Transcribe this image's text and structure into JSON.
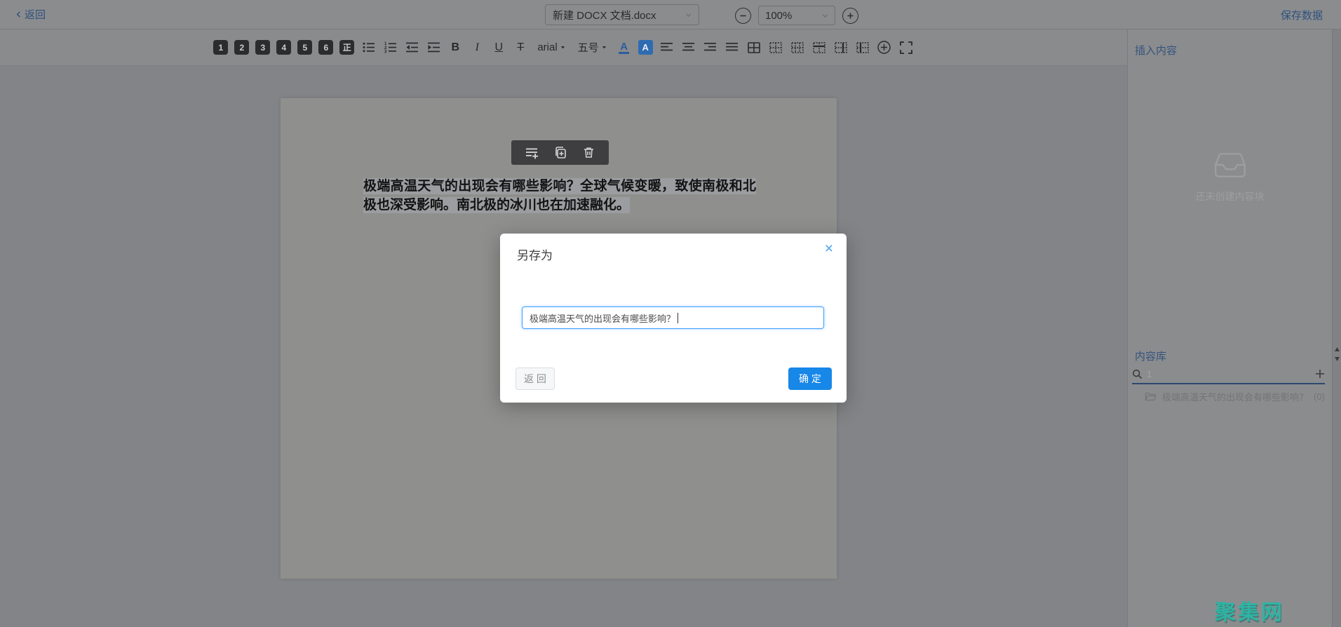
{
  "topbar": {
    "back_label": "返回",
    "doc_title": "新建 DOCX 文档.docx",
    "zoom_value": "100%",
    "save_label": "保存数据"
  },
  "toolbar": {
    "headings": [
      "1",
      "2",
      "3",
      "4",
      "5",
      "6"
    ],
    "normal_label": "正",
    "bold_label": "B",
    "italic_label": "I",
    "underline_label": "U",
    "strike_label": "T",
    "font_name": "arial",
    "font_size": "五号",
    "font_color_letter": "A",
    "highlight_letter": "A"
  },
  "document": {
    "paragraph": "极端高温天气的出现会有哪些影响？全球气候变暖，致使南极和北极也深受影响。南北极的冰川也在加速融化。"
  },
  "dialog": {
    "title": "另存为",
    "close_glyph": "×",
    "input_value": "极端高温天气的出现会有哪些影响？",
    "back_button": "返 回",
    "confirm_button": "确 定"
  },
  "sidebar": {
    "insert_title": "插入内容",
    "empty_text": "还未创建内容块",
    "library_title": "内容库",
    "search_value": "1",
    "item_text": "极端高温天气的出现会有哪些影响？",
    "item_count": "(0)"
  },
  "watermark": "聚集网",
  "colors": {
    "accent_blue": "#1787e8",
    "input_focus_blue": "#409eff",
    "muted_link_blue": "#2f517e",
    "highlight_gray": "#9b9da0",
    "watermark_teal": "#2fb3a4"
  }
}
